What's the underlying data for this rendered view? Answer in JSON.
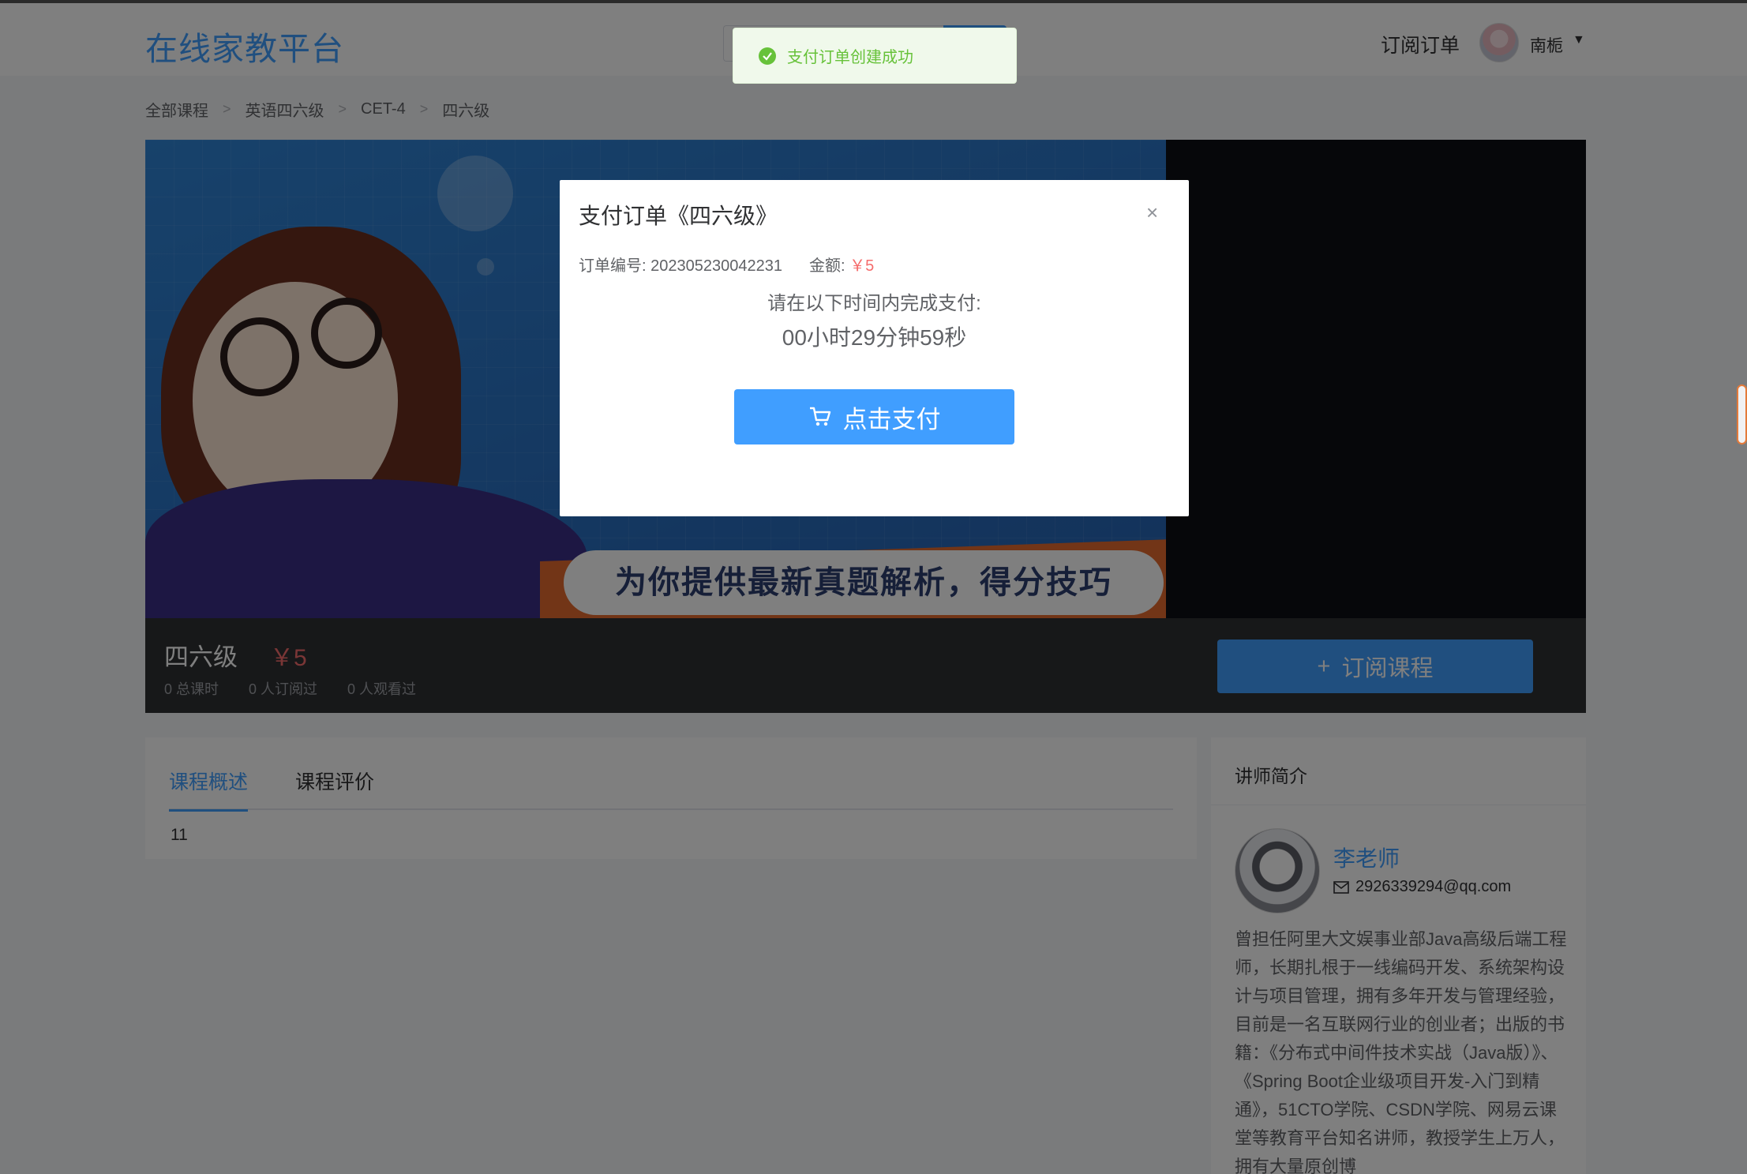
{
  "header": {
    "logo": "在线家教平台",
    "nav_orders": "订阅订单",
    "username": "南栀",
    "caret": "▼"
  },
  "breadcrumb": {
    "items": [
      "全部课程",
      "英语四六级",
      "CET-4",
      "四六级"
    ],
    "separator": ">"
  },
  "banner": {
    "slogan": "为你提供最新真题解析，得分技巧"
  },
  "course": {
    "title": "四六级",
    "price": "￥5",
    "stats": [
      "0 总课时",
      "0 人订阅过",
      "0 人观看过"
    ],
    "subscribe_icon": "+",
    "subscribe_label": "订阅课程"
  },
  "tabs": {
    "items": [
      "课程概述",
      "课程评价"
    ],
    "active": 0,
    "body": "11"
  },
  "teacher": {
    "heading": "讲师简介",
    "name": "李老师",
    "email": "2926339294@qq.com",
    "bio": "曾担任阿里大文娱事业部Java高级后端工程师，长期扎根于一线编码开发、系统架构设计与项目管理，拥有多年开发与管理经验，目前是一名互联网行业的创业者；出版的书籍：《分布式中间件技术实战（Java版）》、《Spring Boot企业级项目开发-入门到精通》，51CTO学院、CSDN学院、网易云课堂等教育平台知名讲师，教授学生上万人，拥有大量原创博"
  },
  "dialog": {
    "title": "支付订单《四六级》",
    "close": "×",
    "order_label": "订单编号: 202305230042231",
    "amount_label": "金额:",
    "amount_value": "￥5",
    "hint": "请在以下时间内完成支付:",
    "timer": "00小时29分钟59秒",
    "pay_label": "点击支付"
  },
  "toast": {
    "message": "支付订单创建成功"
  },
  "colors": {
    "primary": "#409eff",
    "price": "#f56c6c",
    "success": "#67c23a"
  },
  "icons": {
    "cart": "cart-icon",
    "close": "close-icon",
    "success": "check-circle-icon",
    "mail": "mail-icon"
  }
}
